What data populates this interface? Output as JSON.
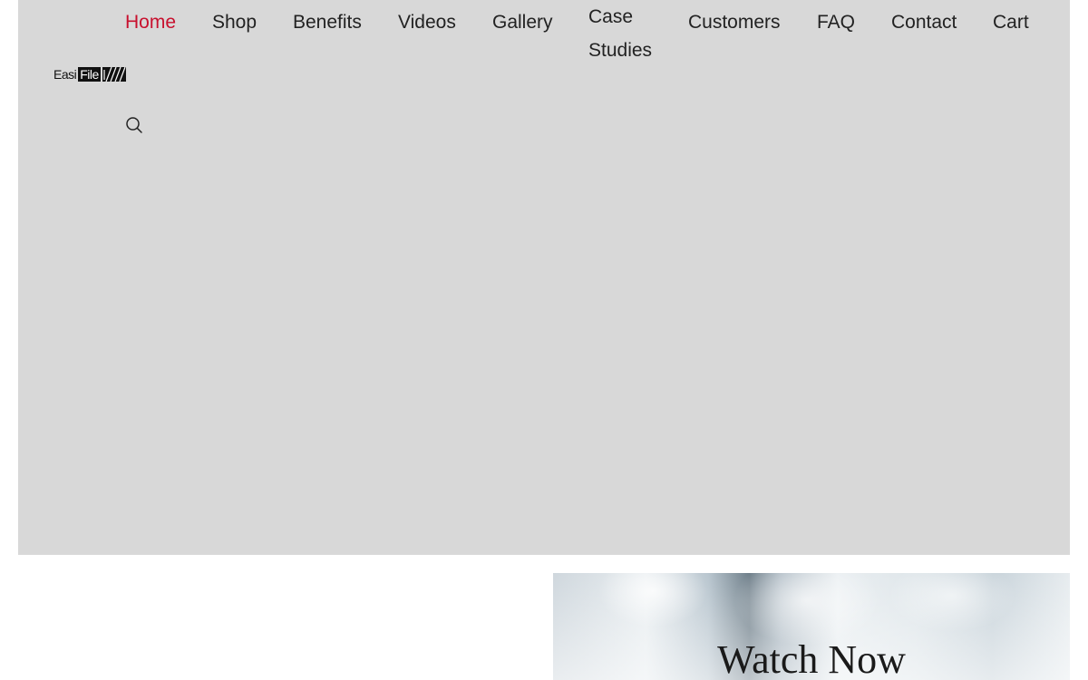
{
  "nav": {
    "items": [
      {
        "label": "Home",
        "active": true
      },
      {
        "label": "Shop"
      },
      {
        "label": "Benefits"
      },
      {
        "label": "Videos"
      },
      {
        "label": "Gallery"
      },
      {
        "label": "Case Studies"
      },
      {
        "label": "Customers"
      },
      {
        "label": "FAQ"
      },
      {
        "label": "Contact"
      },
      {
        "label": "Cart"
      }
    ]
  },
  "logo": {
    "part1": "Easi",
    "part2": "File",
    "part3": "it"
  },
  "search": {
    "icon": "search-icon"
  },
  "video": {
    "title": "Watch Now"
  },
  "colors": {
    "hero_bg": "#d8d8d8",
    "nav_active": "#c8102e",
    "nav_text": "#222222"
  }
}
